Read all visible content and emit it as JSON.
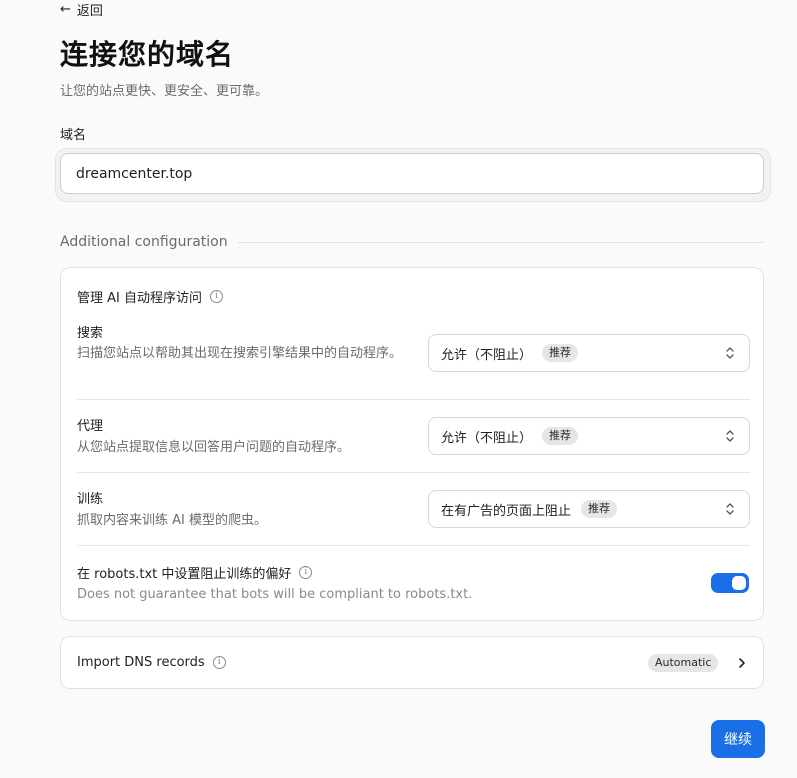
{
  "nav": {
    "back_label": "返回"
  },
  "header": {
    "title": "连接您的域名",
    "subtitle": "让您的站点更快、更安全、更可靠。"
  },
  "domain": {
    "label": "域名",
    "value": "dreamcenter.top"
  },
  "additional": {
    "heading": "Additional configuration",
    "ai_access": {
      "title": "管理 AI 自动程序访问",
      "rows": [
        {
          "title": "搜索",
          "description": "扫描您站点以帮助其出现在搜索引擎结果中的自动程序。",
          "selected": "允许（不阻止）",
          "badge": "推荐"
        },
        {
          "title": "代理",
          "description": "从您站点提取信息以回答用户问题的自动程序。",
          "selected": "允许（不阻止）",
          "badge": "推荐"
        },
        {
          "title": "训练",
          "description": "抓取内容来训练 AI 模型的爬虫。",
          "selected": "在有广告的页面上阻止",
          "badge": "推荐"
        }
      ],
      "robots": {
        "title": "在 robots.txt 中设置阻止训练的偏好",
        "description": "Does not guarantee that bots will be compliant to robots.txt.",
        "enabled": true
      }
    }
  },
  "dns": {
    "label": "Import DNS records",
    "badge": "Automatic"
  },
  "actions": {
    "continue_label": "继续"
  },
  "colors": {
    "accent": "#1a6fe6",
    "background": "#fafafa"
  },
  "icons": {
    "back": "arrow-left-icon",
    "info": "info-icon",
    "select": "chevron-up-down-icon",
    "next": "chevron-right-icon"
  }
}
